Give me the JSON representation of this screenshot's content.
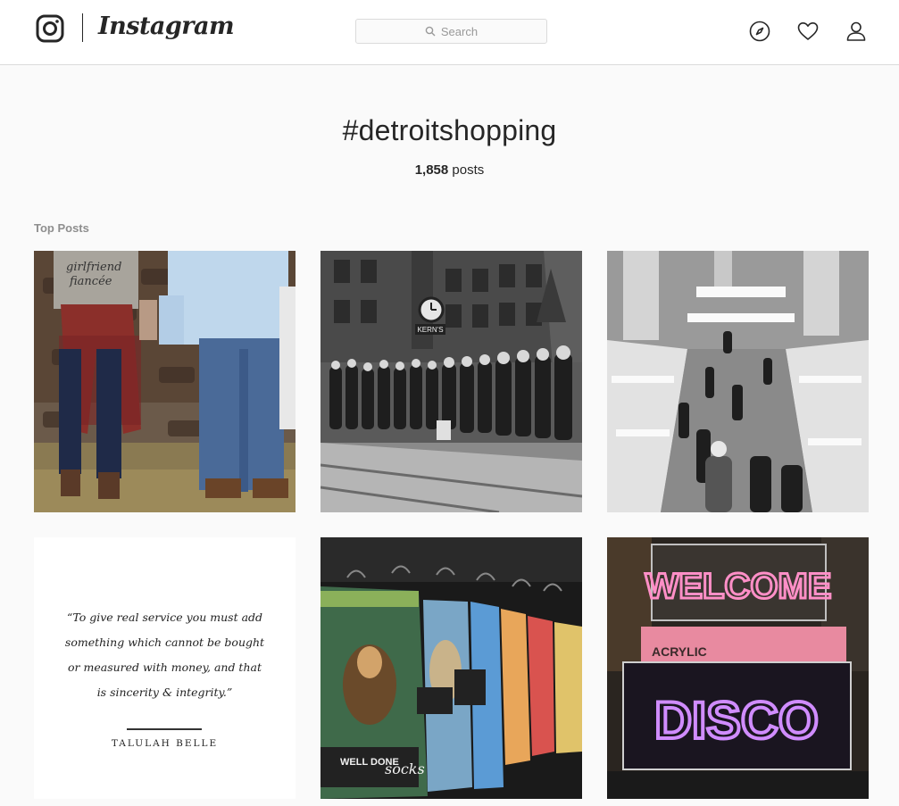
{
  "header": {
    "wordmark": "Instagram",
    "search_placeholder": "Search"
  },
  "hashtag": {
    "title": "#detroitshopping",
    "post_count": "1,858",
    "post_count_suffix": " posts"
  },
  "sections": {
    "top_posts_label": "Top Posts"
  },
  "posts": {
    "quote": {
      "line1": "“To give real service you must add",
      "line2": "something which cannot be bought",
      "line3": "or measured with money, and that",
      "line4": "is sincerity & integrity.”",
      "author": "TALULAH BELLE"
    },
    "clock_sign": "KERN'S",
    "socks_brand": "WELL DONE",
    "socks_label": "socks",
    "neon_top": "WELCOME",
    "neon_bottom": "DISCO",
    "box_label": "ACRYLIC",
    "shirt_text1": "girlfriend",
    "shirt_text2": "fiancée"
  },
  "colors": {
    "border": "#dbdbdb",
    "text": "#262626",
    "muted": "#8e8e8e",
    "neon_pink": "#ff6ad5",
    "neon_purple": "#c77dff"
  }
}
